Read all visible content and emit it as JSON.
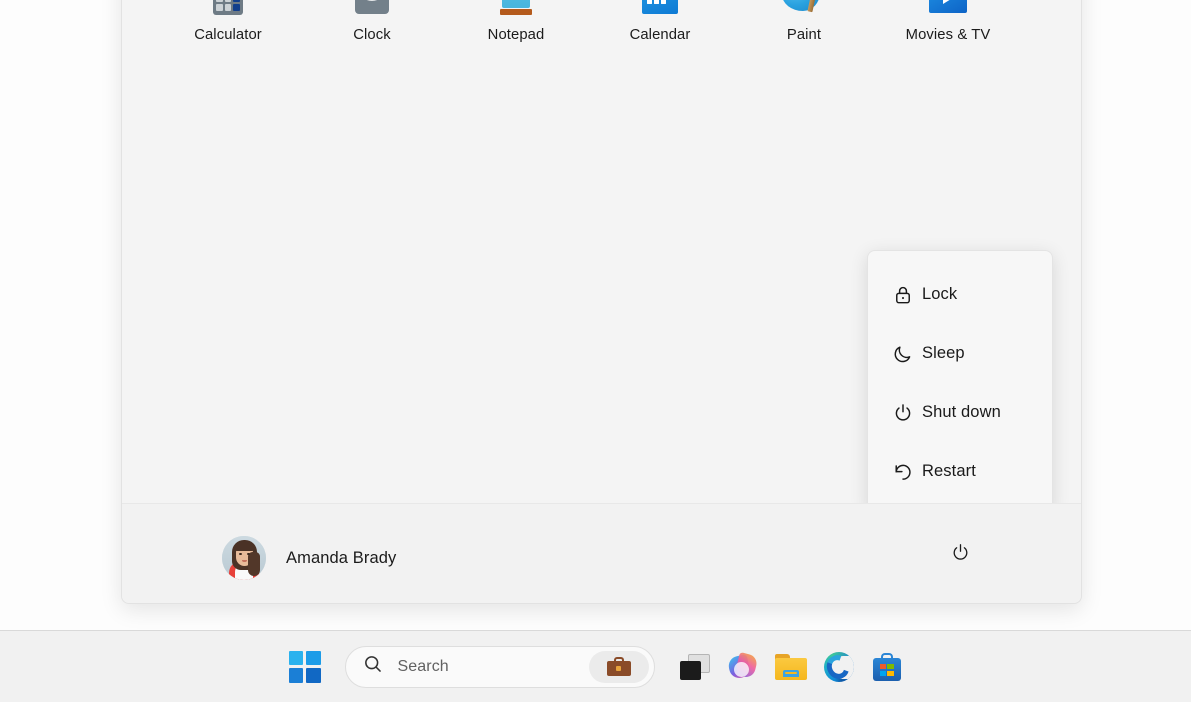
{
  "start_menu": {
    "pinned_apps": [
      {
        "label": "Calculator",
        "icon": "calculator-icon"
      },
      {
        "label": "Clock",
        "icon": "clock-icon"
      },
      {
        "label": "Notepad",
        "icon": "notepad-icon"
      },
      {
        "label": "Calendar",
        "icon": "calendar-icon"
      },
      {
        "label": "Paint",
        "icon": "paint-icon"
      },
      {
        "label": "Movies & TV",
        "icon": "movies-and-tv-icon"
      }
    ],
    "account": {
      "name": "Amanda Brady",
      "avatar": "user-avatar-photo"
    },
    "power_button_icon": "power-icon"
  },
  "power_menu": {
    "items": [
      {
        "label": "Lock",
        "icon": "lock-icon"
      },
      {
        "label": "Sleep",
        "icon": "moon-icon"
      },
      {
        "label": "Shut down",
        "icon": "power-icon"
      },
      {
        "label": "Restart",
        "icon": "restart-icon"
      }
    ]
  },
  "taskbar": {
    "start_button": {
      "icon": "windows-logo-icon"
    },
    "search": {
      "placeholder": "Search",
      "icon": "search-icon",
      "badge_icon": "briefcase-icon"
    },
    "buttons": [
      {
        "name": "task-view",
        "icon": "task-view-icon"
      },
      {
        "name": "copilot",
        "icon": "copilot-icon"
      },
      {
        "name": "file-explorer",
        "icon": "folder-icon"
      },
      {
        "name": "microsoft-edge",
        "icon": "edge-icon"
      },
      {
        "name": "microsoft-store",
        "icon": "store-icon"
      }
    ]
  },
  "colors": {
    "panel_bg": "#f4f4f4",
    "taskbar_bg": "#f1f1f1",
    "text": "#1b1b1b",
    "accent": "#0f6cbd"
  }
}
